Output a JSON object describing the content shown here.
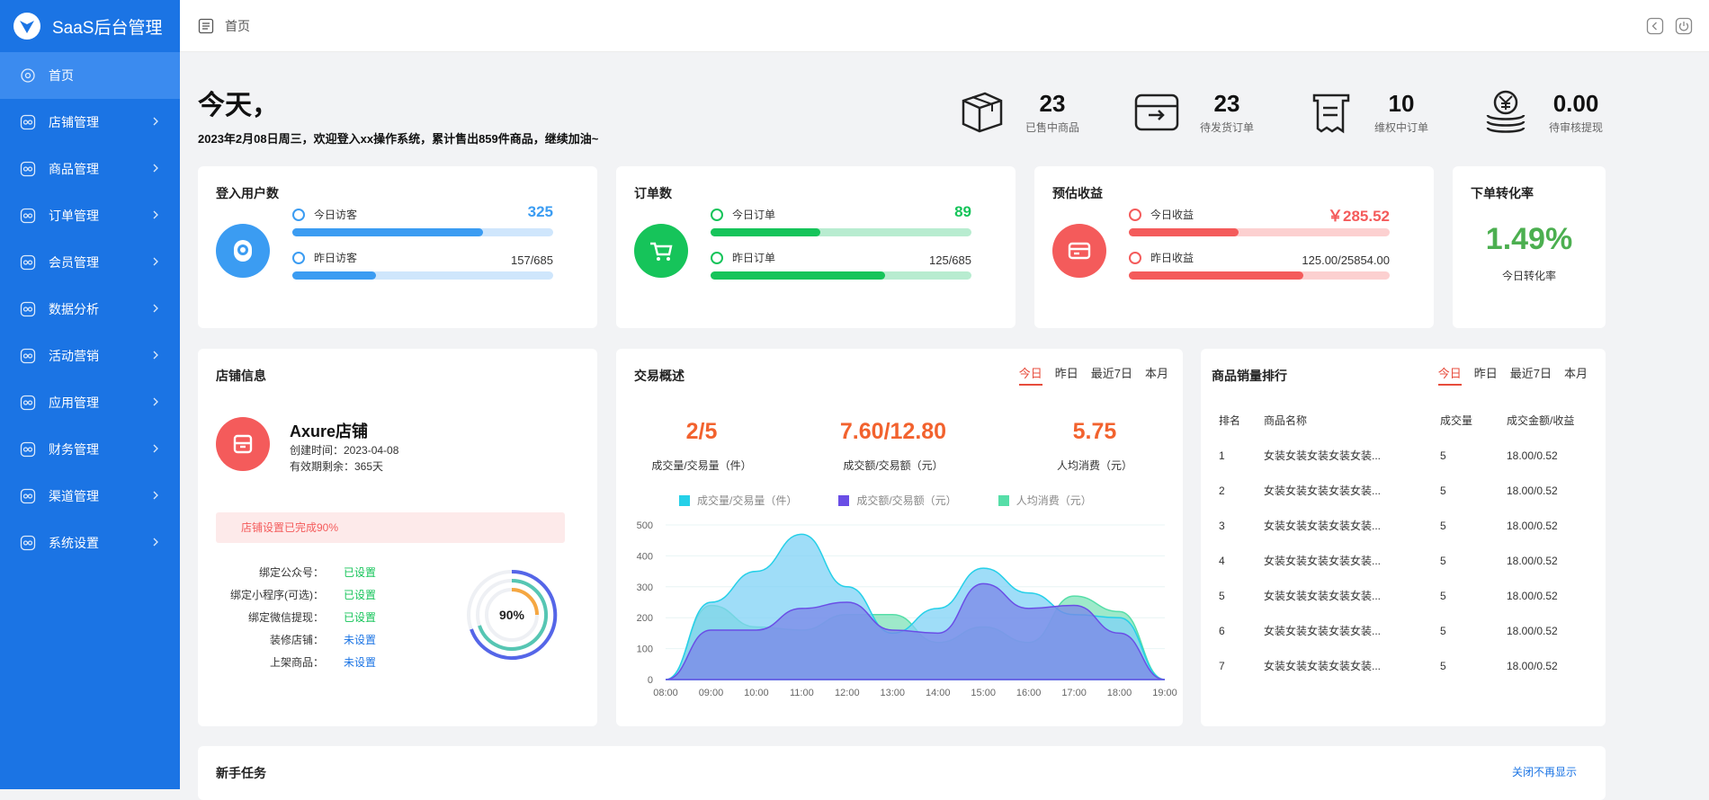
{
  "app": {
    "title": "SaaS后台管理"
  },
  "sidebar": {
    "items": [
      {
        "label": "首页",
        "active": true
      },
      {
        "label": "店铺管理"
      },
      {
        "label": "商品管理"
      },
      {
        "label": "订单管理"
      },
      {
        "label": "会员管理"
      },
      {
        "label": "数据分析"
      },
      {
        "label": "活动营销"
      },
      {
        "label": "应用管理"
      },
      {
        "label": "财务管理"
      },
      {
        "label": "渠道管理"
      },
      {
        "label": "系统设置"
      }
    ]
  },
  "header": {
    "breadcrumb": "首页"
  },
  "welcome": {
    "title": "今天，",
    "subtitle": "2023年2月08日周三，欢迎登入xx操作系统，累计售出859件商品，继续加油~"
  },
  "stats": [
    {
      "value": "23",
      "label": "已售中商品",
      "icon": "box-icon"
    },
    {
      "value": "23",
      "label": "待发货订单",
      "icon": "shipping-icon"
    },
    {
      "value": "10",
      "label": "维权中订单",
      "icon": "receipt-icon"
    },
    {
      "value": "0.00",
      "label": "待审核提现",
      "icon": "coins-icon"
    }
  ],
  "users": {
    "title": "登入用户数",
    "today_label": "今日访客",
    "today_value": "325",
    "today_pct": 0.73,
    "yest_label": "昨日访客",
    "yest_value": "157/685",
    "yest_pct": 0.32
  },
  "orders": {
    "title": "订单数",
    "today_label": "今日订单",
    "today_value": "89",
    "today_pct": 0.42,
    "yest_label": "昨日订单",
    "yest_value": "125/685",
    "yest_pct": 0.67
  },
  "revenue": {
    "title": "预估收益",
    "today_label": "今日收益",
    "today_value": "￥285.52",
    "today_pct": 0.42,
    "yest_label": "昨日收益",
    "yest_value": "125.00/25854.00",
    "yest_pct": 0.67
  },
  "conversion": {
    "title": "下单转化率",
    "value": "1.49%",
    "label": "今日转化率"
  },
  "shop": {
    "title": "店铺信息",
    "name": "Axure店铺",
    "created": "创建时间：2023-04-08",
    "valid": "有效期剩余：365天",
    "progress_text": "店铺设置已完成90%",
    "gauge": "90%",
    "settings": [
      {
        "label": "绑定公众号：",
        "value": "已设置",
        "done": true
      },
      {
        "label": "绑定小程序(可选)：",
        "value": "已设置",
        "done": true
      },
      {
        "label": "绑定微信提现：",
        "value": "已设置",
        "done": true
      },
      {
        "label": "装修店铺：",
        "value": "未设置",
        "done": false
      },
      {
        "label": "上架商品：",
        "value": "未设置",
        "done": false
      }
    ]
  },
  "trade": {
    "title": "交易概述",
    "tabs": [
      "今日",
      "昨日",
      "最近7日",
      "本月"
    ],
    "kpis": [
      {
        "value": "2/5",
        "label": "成交量/交易量（件）"
      },
      {
        "value": "7.60/12.80",
        "label": "成交额/交易额（元）"
      },
      {
        "value": "5.75",
        "label": "人均消费（元）"
      }
    ],
    "legend": [
      "成交量/交易量（件）",
      "成交额/交易额（元）",
      "人均消费（元）"
    ]
  },
  "chart_data": {
    "type": "area",
    "x": [
      "08:00",
      "09:00",
      "10:00",
      "11:00",
      "12:00",
      "13:00",
      "14:00",
      "15:00",
      "16:00",
      "17:00",
      "18:00",
      "19:00"
    ],
    "ylim": [
      0,
      500
    ],
    "yticks": [
      0,
      100,
      200,
      300,
      400,
      500
    ],
    "series": [
      {
        "name": "成交量/交易量（件）",
        "color": "#7fd1f5",
        "values": [
          0,
          250,
          350,
          470,
          300,
          150,
          230,
          360,
          280,
          210,
          200,
          0
        ]
      },
      {
        "name": "成交额/交易额（元）",
        "color": "#7b85e8",
        "values": [
          0,
          160,
          160,
          230,
          250,
          160,
          150,
          310,
          230,
          240,
          150,
          0
        ]
      },
      {
        "name": "人均消费（元）",
        "color": "#7ee2b8",
        "values": [
          0,
          240,
          170,
          160,
          210,
          210,
          120,
          170,
          120,
          270,
          220,
          0
        ]
      }
    ]
  },
  "ranking": {
    "title": "商品销量排行",
    "tabs": [
      "今日",
      "昨日",
      "最近7日",
      "本月"
    ],
    "headers": [
      "排名",
      "商品名称",
      "成交量",
      "成交金额/收益"
    ],
    "rows": [
      [
        "1",
        "女装女装女装女装女装...",
        "5",
        "18.00/0.52"
      ],
      [
        "2",
        "女装女装女装女装女装...",
        "5",
        "18.00/0.52"
      ],
      [
        "3",
        "女装女装女装女装女装...",
        "5",
        "18.00/0.52"
      ],
      [
        "4",
        "女装女装女装女装女装...",
        "5",
        "18.00/0.52"
      ],
      [
        "5",
        "女装女装女装女装女装...",
        "5",
        "18.00/0.52"
      ],
      [
        "6",
        "女装女装女装女装女装...",
        "5",
        "18.00/0.52"
      ],
      [
        "7",
        "女装女装女装女装女装...",
        "5",
        "18.00/0.52"
      ]
    ]
  },
  "tasks": {
    "title": "新手任务",
    "close_label": "关闭不再显示"
  }
}
